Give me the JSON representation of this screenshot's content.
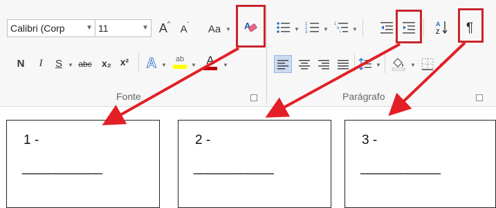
{
  "ribbon": {
    "font_group": {
      "font_name": "Calibri (Corp",
      "font_size": "11",
      "grow_font": "A",
      "shrink_font": "A",
      "change_case": "Aa",
      "clear_formatting_icon": "eraser-icon",
      "bold": "N",
      "italic": "I",
      "underline": "S",
      "strikethrough": "abc",
      "subscript": "x₂",
      "superscript": "x²",
      "text_effects": "A",
      "highlight_label": "ab",
      "highlight_color": "#ffff00",
      "font_color_label": "A",
      "font_color": "#c00000",
      "label": "Fonte"
    },
    "paragraph_group": {
      "bullets_icon": "bulleted-list-icon",
      "numbering_icon": "numbered-list-icon",
      "multilevel_icon": "multilevel-list-icon",
      "decrease_indent_icon": "decrease-indent-icon",
      "increase_indent_icon": "increase-indent-icon",
      "sort_icon": "sort-icon",
      "pilcrow": "¶",
      "label": "Parágrafo"
    }
  },
  "highlight_color": "#c8242b",
  "answers": [
    {
      "number": "1 -",
      "blank": "____________"
    },
    {
      "number": "2 -",
      "blank": "____________"
    },
    {
      "number": "3 -",
      "blank": "____________"
    }
  ]
}
